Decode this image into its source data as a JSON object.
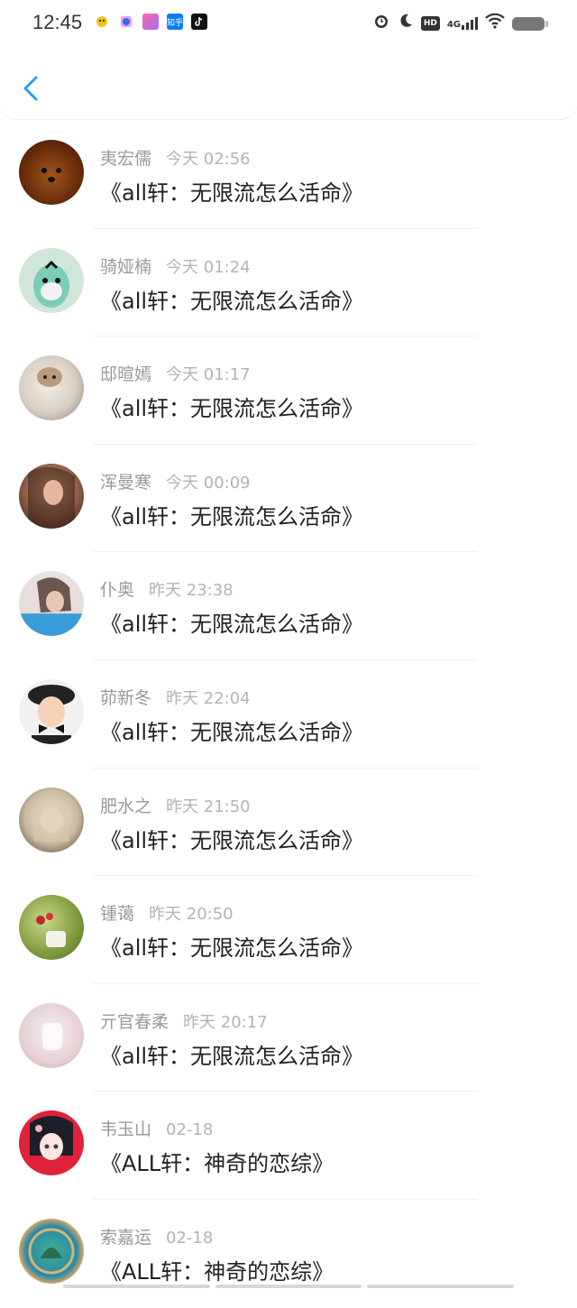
{
  "status_bar": {
    "time": "12:45",
    "apps": [
      "baidu-icon",
      "taobao-icon",
      "pinduoduo-icon",
      "zhihu-icon",
      "tiktok-icon"
    ],
    "zhihu_label": "知乎",
    "hd_label": "HD",
    "network_label": "4G"
  },
  "header": {
    "back_icon": "chevron-left-icon",
    "accent": "#2a9cf4"
  },
  "items": [
    {
      "name": "夷宏儒",
      "time": "今天 02:56",
      "title": "《all轩：无限流怎么活命》"
    },
    {
      "name": "骑娅楠",
      "time": "今天 01:24",
      "title": "《all轩：无限流怎么活命》"
    },
    {
      "name": "邸暄嫣",
      "time": "今天 01:17",
      "title": "《all轩：无限流怎么活命》"
    },
    {
      "name": "浑曼寒",
      "time": "今天 00:09",
      "title": "《all轩：无限流怎么活命》"
    },
    {
      "name": "仆奥",
      "time": "昨天 23:38",
      "title": "《all轩：无限流怎么活命》"
    },
    {
      "name": "茆新冬",
      "time": "昨天 22:04",
      "title": "《all轩：无限流怎么活命》"
    },
    {
      "name": "肥水之",
      "time": "昨天 21:50",
      "title": "《all轩：无限流怎么活命》"
    },
    {
      "name": "锺蔼",
      "time": "昨天 20:50",
      "title": "《all轩：无限流怎么活命》"
    },
    {
      "name": "亓官春柔",
      "time": "昨天 20:17",
      "title": "《all轩：无限流怎么活命》"
    },
    {
      "name": "韦玉山",
      "time": "02-18",
      "title": "《ALL轩：神奇的恋综》"
    },
    {
      "name": "索嘉运",
      "time": "02-18",
      "title": "《ALL轩：神奇的恋综》"
    }
  ]
}
